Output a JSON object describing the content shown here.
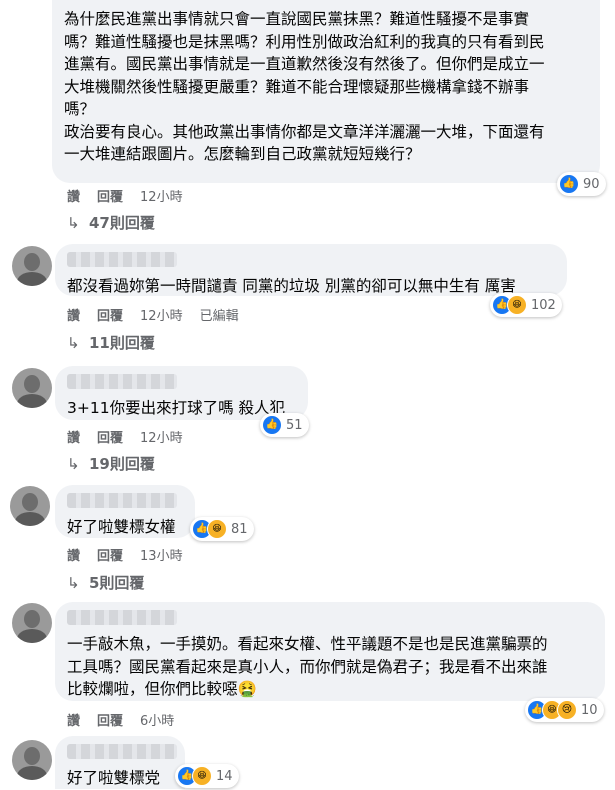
{
  "comments": [
    {
      "text": "為什麼民進黨出事情就只會一直說國民黨抹黑？難道性騷擾不是事實\n嗎？難道性騷擾也是抹黑嗎？利用性別做政治紅利的我真的只有看到民\n進黨有。國民黨出事情就是一直道歉然後沒有然後了。但你們是成立一\n大堆機關然後性騷擾更嚴重？難道不能合理懷疑那些機構拿錢不辦事\n嗎？\n政治要有良心。其他政黨出事情你都是文章洋洋灑灑一大堆，下面還有\n一大堆連結跟圖片。怎麼輪到自己政黨就短短幾行？",
      "like": "讚",
      "reply": "回覆",
      "time": "12小時",
      "reactions": "90",
      "replies": "47則回覆"
    },
    {
      "text": "都沒看過妳第一時間譴責 同黨的垃圾 別黨的卻可以無中生有 厲害",
      "like": "讚",
      "reply": "回覆",
      "time": "12小時",
      "edited": "已編輯",
      "reactions": "102",
      "replies": "11則回覆"
    },
    {
      "text": "3+11你要出來打球了嗎 殺人犯",
      "like": "讚",
      "reply": "回覆",
      "time": "12小時",
      "reactions": "51",
      "replies": "19則回覆"
    },
    {
      "text": "好了啦雙標女權",
      "like": "讚",
      "reply": "回覆",
      "time": "13小時",
      "reactions": "81",
      "replies": "5則回覆"
    },
    {
      "text": "一手敲木魚，一手摸奶。看起來女權、性平議題不是也是民進黨騙票的\n工具嗎？國民黨看起來是真小人，而你們就是偽君子；我是看不出來誰\n比較爛啦，但你們比較噁🤮",
      "like": "讚",
      "reply": "回覆",
      "time": "6小時",
      "reactions": "10"
    },
    {
      "text": "好了啦雙標党",
      "reactions": "14"
    }
  ],
  "colors": {
    "bubble": "#f0f2f5",
    "meta": "#65676b",
    "like_blue": "#1877f2",
    "haha_yellow": "#f7b125"
  },
  "icons": [
    "like-icon",
    "haha-icon",
    "sad-icon",
    "reply-arrow-icon"
  ]
}
